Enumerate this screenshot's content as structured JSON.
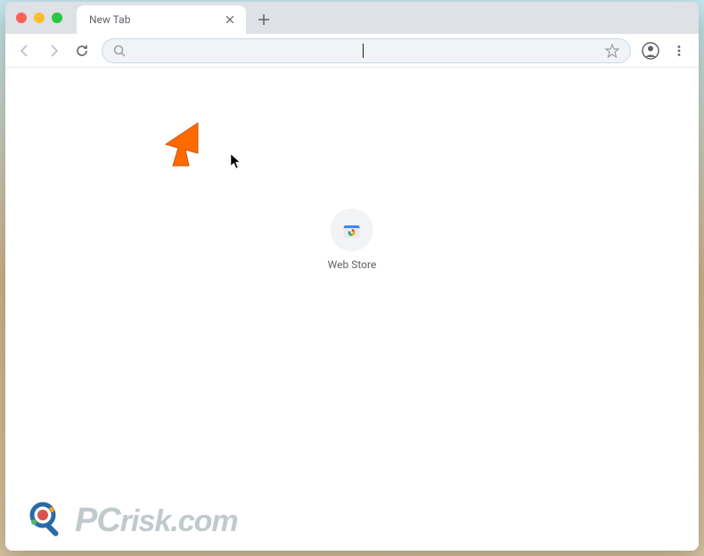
{
  "tab": {
    "title": "New Tab"
  },
  "omnibox": {
    "value": "",
    "placeholder": ""
  },
  "shortcuts": [
    {
      "label": "Web Store"
    }
  ],
  "watermark": {
    "text_pc": "PC",
    "text_rest": "risk.com"
  },
  "colors": {
    "arrow": "#ff6a00",
    "toolbar_bg": "#dee1e6",
    "omnibox_bg": "#f1f3f4",
    "text_gray": "#5f6368"
  }
}
